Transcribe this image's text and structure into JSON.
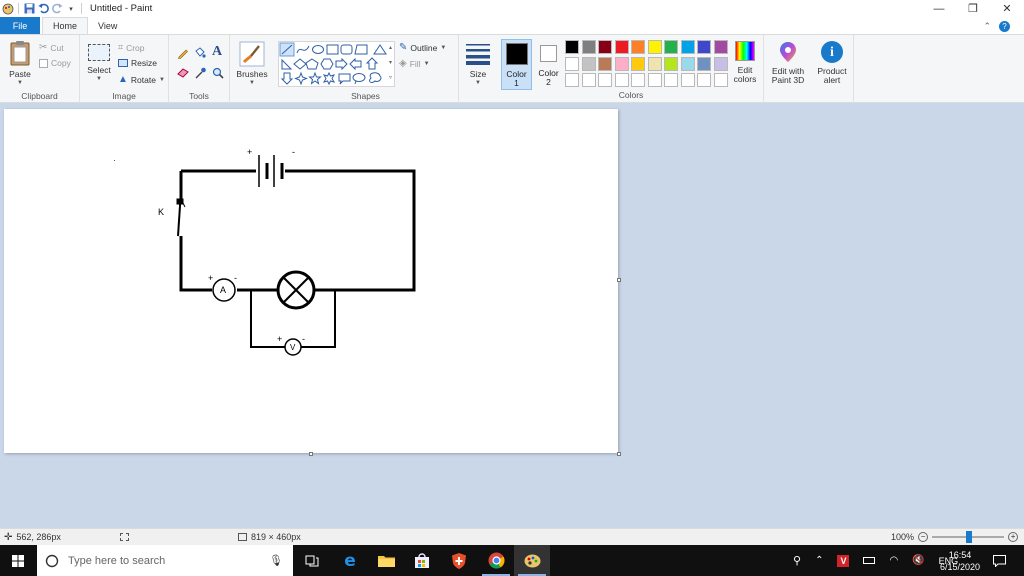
{
  "window": {
    "title": "Untitled - Paint",
    "controls": {
      "minimize": "—",
      "maximize": "❐",
      "close": "✕"
    }
  },
  "tabs": {
    "file": "File",
    "home": "Home",
    "view": "View"
  },
  "ribbon": {
    "clipboard": {
      "label": "Clipboard",
      "paste": "Paste",
      "cut": "Cut",
      "copy": "Copy"
    },
    "image": {
      "label": "Image",
      "select": "Select",
      "crop": "Crop",
      "resize": "Resize",
      "rotate": "Rotate"
    },
    "tools": {
      "label": "Tools"
    },
    "brushes": {
      "label": "Brushes"
    },
    "shapes": {
      "label": "Shapes",
      "outline": "Outline",
      "fill": "Fill"
    },
    "size": {
      "label": "Size"
    },
    "color1": {
      "label": "Color",
      "num": "1",
      "value": "#000000"
    },
    "color2": {
      "label": "Color",
      "num": "2",
      "value": "#ffffff"
    },
    "colors": {
      "label": "Colors",
      "row1": [
        "#000000",
        "#7f7f7f",
        "#880015",
        "#ed1c24",
        "#ff7f27",
        "#fff200",
        "#22b14c",
        "#00a2e8",
        "#3f48cc",
        "#a349a4"
      ],
      "row2": [
        "#ffffff",
        "#c3c3c3",
        "#b97a57",
        "#ffaec9",
        "#ffc90e",
        "#efe4b0",
        "#b5e61d",
        "#99d9ea",
        "#7092be",
        "#c8bfe7"
      ],
      "row3": [
        "#ffffff",
        "#ffffff",
        "#ffffff",
        "#ffffff",
        "#ffffff",
        "#ffffff",
        "#ffffff",
        "#ffffff",
        "#ffffff",
        "#ffffff"
      ]
    },
    "edit_colors": {
      "line1": "Edit",
      "line2": "colors"
    },
    "paint3d": {
      "line1": "Edit with",
      "line2": "Paint 3D"
    },
    "product_alert": {
      "line1": "Product",
      "line2": "alert"
    }
  },
  "canvas_drawing": {
    "switch_label": "K",
    "ammeter_label": "A",
    "voltmeter_label": "V",
    "plus": "+",
    "minus": "-"
  },
  "status": {
    "cursor_position": "562, 286px",
    "canvas_size": "819 × 460px",
    "zoom": "100%"
  },
  "taskbar": {
    "search_placeholder": "Type here to search",
    "language": "ENG",
    "time": "16:54",
    "date": "6/15/2020"
  }
}
